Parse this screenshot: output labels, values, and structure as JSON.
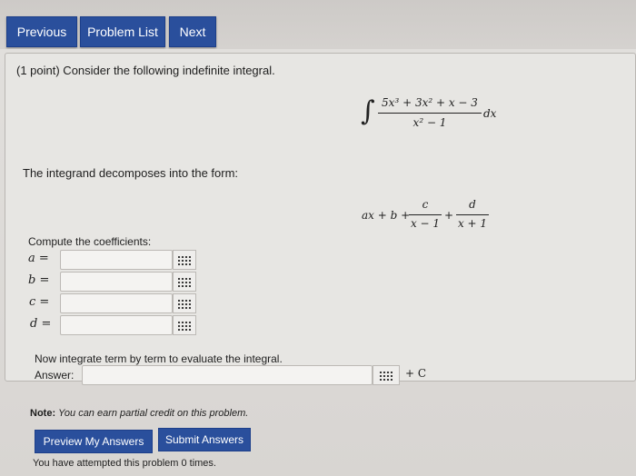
{
  "nav": {
    "previous_label": "Previous",
    "problem_list_label": "Problem List",
    "next_label": "Next"
  },
  "problem": {
    "intro": "(1 point) Consider the following indefinite integral.",
    "integral_numerator": "5x³ + 3x² + x − 3",
    "integral_denominator": "x² − 1",
    "integral_dx": "dx",
    "decomp_text": "The integrand decomposes into the form:",
    "decomp_prefix": "ax + b +",
    "frac_c_num": "c",
    "frac_c_den": "x − 1",
    "plus": "+",
    "frac_d_num": "d",
    "frac_d_den": "x + 1",
    "compute_label": "Compute the coefficients:",
    "coefficients": [
      {
        "label": "a =",
        "value": ""
      },
      {
        "label": "b =",
        "value": ""
      },
      {
        "label": "c =",
        "value": ""
      },
      {
        "label": "d =",
        "value": ""
      }
    ],
    "integrate_text": "Now integrate term by term to evaluate the integral.",
    "answer_label": "Answer:",
    "answer_value": "",
    "plus_c": "+ C",
    "note_label": "Note:",
    "note_text": "You can earn partial credit on this problem."
  },
  "actions": {
    "preview_label": "Preview My Answers",
    "submit_label": "Submit Answers"
  },
  "footer": {
    "attempts_text": "You have attempted this problem 0 times."
  }
}
